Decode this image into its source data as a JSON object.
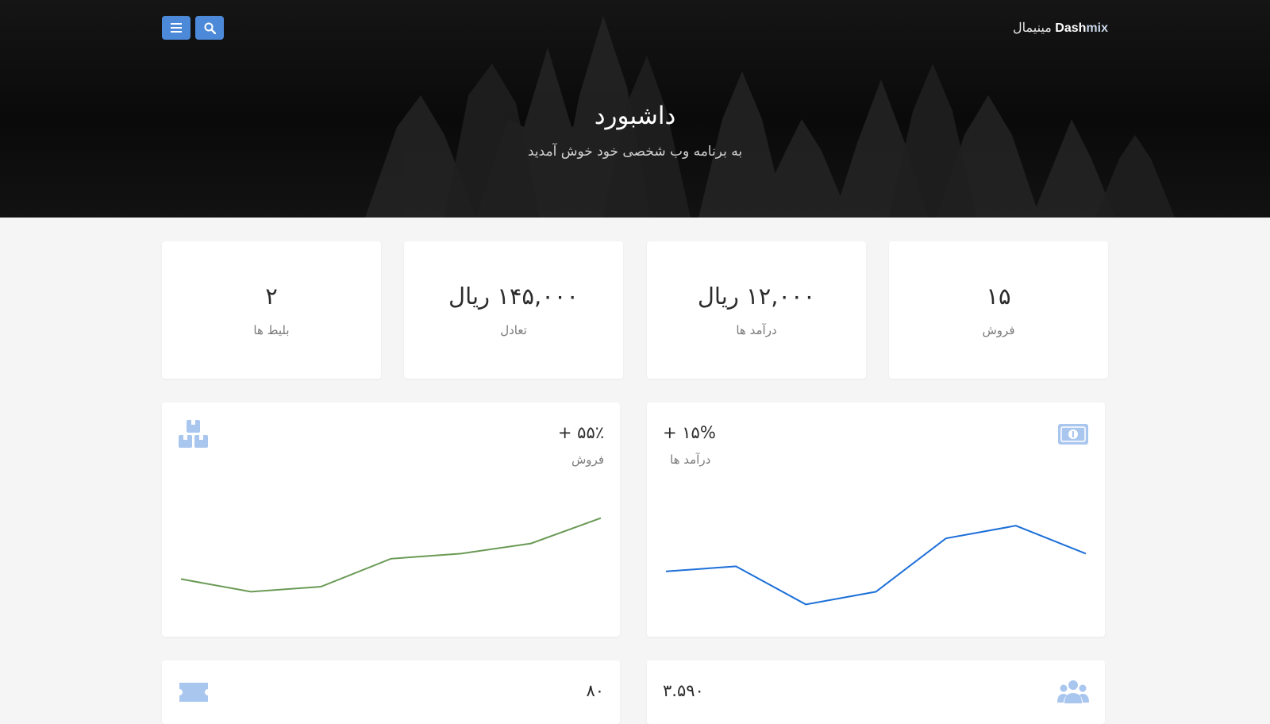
{
  "header": {
    "brand_dash": "Dash",
    "brand_mix": "mix",
    "brand_suffix": "مینیمال",
    "menu_icon": "bars-icon",
    "search_icon": "search-icon",
    "title": "داشبورد",
    "subtitle": "به برنامه وب شخصی خود خوش آمدید",
    "button_color": "#4c8ad9"
  },
  "stats": [
    {
      "value": "۱۵",
      "label": "فروش"
    },
    {
      "value": "۱۲,۰۰۰ ریال",
      "label": "درآمد ها"
    },
    {
      "value": "۱۴۵,۰۰۰ ریال",
      "label": "تعادل"
    },
    {
      "value": "۲",
      "label": "بلیط ها"
    }
  ],
  "cards": {
    "earnings": {
      "value": "+ ۱۵%",
      "label": "درآمد ها",
      "icon": "money-bill-icon",
      "icon_color": "#a9c6ef",
      "line_color": "#1c6fd8"
    },
    "sales": {
      "value": "+ ۵۵٪",
      "label": "فروش",
      "icon": "boxes-icon",
      "icon_color": "#a9c6ef",
      "line_color": "#6a9a55"
    },
    "users": {
      "value": "۳.۵۹۰",
      "icon": "users-icon",
      "icon_color": "#a9c6ef"
    },
    "tickets": {
      "value": "۸۰",
      "icon": "ticket-icon",
      "icon_color": "#a9c6ef"
    }
  },
  "chart_data": [
    {
      "type": "line",
      "x": [
        1,
        2,
        3,
        4,
        5,
        6,
        7
      ],
      "series": [
        {
          "values": [
            31,
            33,
            18,
            23,
            44,
            49,
            38
          ],
          "color": "#1c6fd8"
        }
      ],
      "ylim": [
        10,
        60
      ],
      "grid": false
    },
    {
      "type": "line",
      "x": [
        1,
        2,
        3,
        4,
        5,
        6,
        7
      ],
      "series": [
        {
          "values": [
            28,
            23,
            25,
            36,
            38,
            42,
            52
          ],
          "color": "#6a9a55"
        }
      ],
      "ylim": [
        10,
        60
      ],
      "grid": false
    }
  ]
}
